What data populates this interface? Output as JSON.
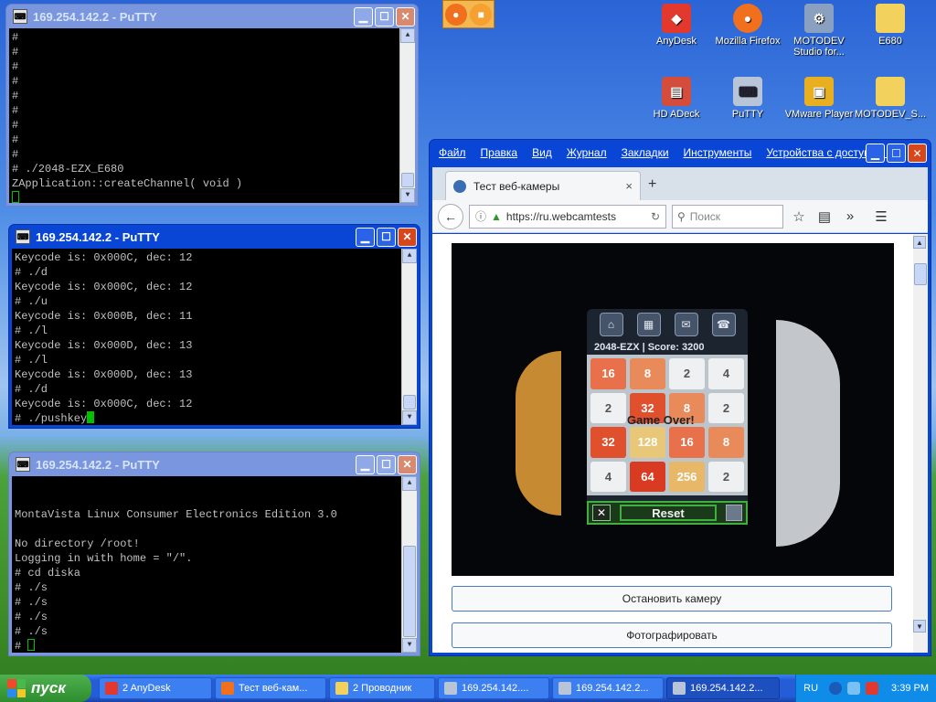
{
  "desktop": {
    "icons": [
      {
        "label": "AnyDesk",
        "icon": "anydesk-icon",
        "color": "#e2382e"
      },
      {
        "label": "Mozilla Firefox",
        "icon": "firefox-icon",
        "color": "#f0701e"
      },
      {
        "label": "MOTODEV Studio for...",
        "icon": "motodev-studio-icon",
        "color": "#8aa0c0"
      },
      {
        "label": "E680",
        "icon": "folder-icon",
        "color": "#f2d25c"
      },
      {
        "label": "HD ADeck",
        "icon": "hd-adeck-icon",
        "color": "#d44c3c"
      },
      {
        "label": "PuTTY",
        "icon": "putty-icon",
        "color": "#b8c4d8"
      },
      {
        "label": "VMware Player",
        "icon": "vmware-icon",
        "color": "#e8b020"
      },
      {
        "label": "MOTODEV_S...",
        "icon": "folder-icon",
        "color": "#f2d25c"
      }
    ]
  },
  "putty1": {
    "title": "169.254.142.2 - PuTTY",
    "lines": [
      "#",
      "#",
      "#",
      "#",
      "#",
      "#",
      "#",
      "#",
      "#",
      "# ./2048-EZX_E680",
      "ZApplication::createChannel( void )"
    ],
    "prompt": ""
  },
  "putty2": {
    "title": "169.254.142.2 - PuTTY",
    "lines": [
      "Keycode is: 0x000C, dec: 12",
      "# ./d",
      "Keycode is: 0x000C, dec: 12",
      "# ./u",
      "Keycode is: 0x000B, dec: 11",
      "# ./l",
      "Keycode is: 0x000D, dec: 13",
      "# ./l",
      "Keycode is: 0x000D, dec: 13",
      "# ./d",
      "Keycode is: 0x000C, dec: 12"
    ],
    "prompt": "# ./pushkey"
  },
  "putty3": {
    "title": "169.254.142.2 - PuTTY",
    "lines": [
      "",
      "",
      "MontaVista Linux Consumer Electronics Edition 3.0",
      "",
      "No directory /root!",
      "Logging in with home = \"/\".",
      "# cd diska",
      "# ./s",
      "# ./s",
      "# ./s",
      "# ./s"
    ],
    "prompt": "# "
  },
  "firefox": {
    "menu": [
      "Файл",
      "Правка",
      "Вид",
      "Журнал",
      "Закладки",
      "Инструменты",
      "Устройства с доступом к"
    ],
    "tab_title": "Тест веб-камеры",
    "tab_close": "×",
    "new_tab": "+",
    "url": "https://ru.webcamtests",
    "search_placeholder": "Поиск",
    "buttons": {
      "stop": "Остановить камеру",
      "photo": "Фотографировать"
    }
  },
  "game": {
    "score_text": "2048-EZX | Score: 3200",
    "tiles": [
      "16",
      "8",
      "2",
      "4",
      "2",
      "32",
      "8",
      "2",
      "32",
      "128",
      "16",
      "8",
      "4",
      "64",
      "256",
      "2"
    ],
    "tile_colors": [
      "#e8704a",
      "#e88a5a",
      "#eef0f2",
      "#eef0f2",
      "#eef0f2",
      "#e0502c",
      "#e88a5a",
      "#eef0f2",
      "#e0502c",
      "#e8c878",
      "#e8704a",
      "#e88a5a",
      "#eef0f2",
      "#d83a22",
      "#e8b868",
      "#eef0f2"
    ],
    "game_over": "Game Over!",
    "reset": "Reset",
    "close": "✕"
  },
  "taskbar": {
    "start": "пуск",
    "items": [
      {
        "label": "2 AnyDesk",
        "color": "#e2382e",
        "active": false
      },
      {
        "label": "Тест веб-кам...",
        "color": "#f0701e",
        "active": false
      },
      {
        "label": "2 Проводник",
        "color": "#f2d25c",
        "active": false
      },
      {
        "label": "169.254.142....",
        "color": "#b8c4d8",
        "active": false
      },
      {
        "label": "169.254.142.2...",
        "color": "#b8c4d8",
        "active": false
      },
      {
        "label": "169.254.142.2...",
        "color": "#b8c4d8",
        "active": true
      }
    ],
    "lang": "RU",
    "clock": "3:39 PM"
  },
  "colors": {
    "terminal_cursor": "#00c000",
    "title_active": "#0a46d6",
    "title_inactive": "#7a96df"
  }
}
